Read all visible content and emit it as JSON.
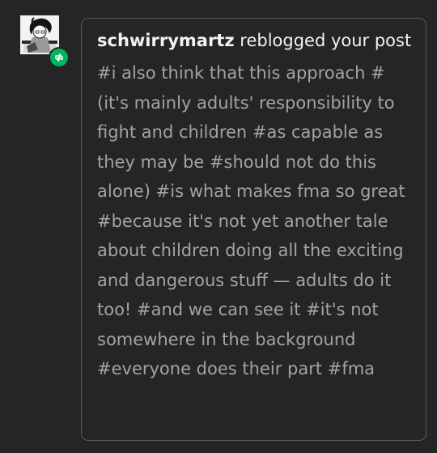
{
  "notification": {
    "username": "schwirrymartz",
    "action_text": "reblogged your post",
    "tags_text": "#i also think that this approach #(it's mainly adults' responsibility to fight and children #as capable as they may be #should not do this alone) #is what makes fma so great #because it's not yet another tale about children doing all the exciting and dangerous stuff — adults do it too! #and we can see it #it's not somewhere in the background #everyone does their part #fma"
  },
  "icons": {
    "avatar": "user-avatar-illustration",
    "badge": "reblog-icon"
  },
  "colors": {
    "background": "#252525",
    "card_border": "#5a5a5a",
    "username_text": "#f2f2f2",
    "tags_text": "#a3a3a3",
    "reblog_badge": "#00b55f"
  }
}
